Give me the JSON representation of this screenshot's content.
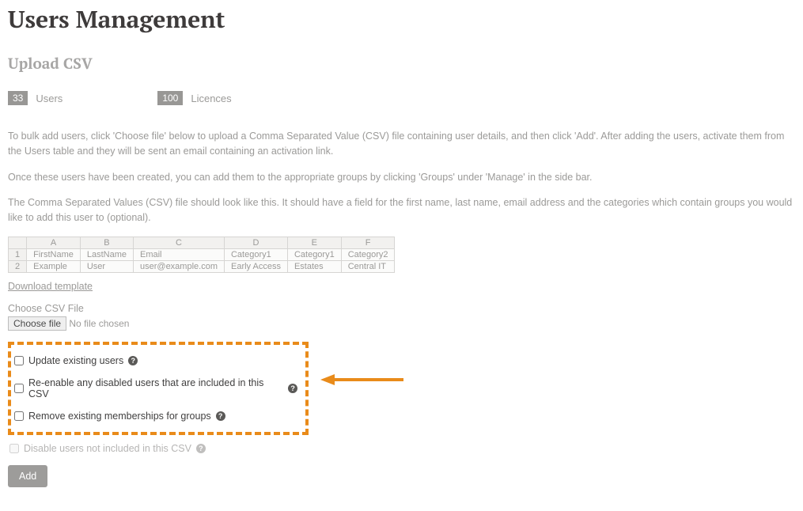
{
  "page_title": "Users Management",
  "section_title": "Upload CSV",
  "stats": {
    "users_count": "33",
    "users_label": "Users",
    "licences_count": "100",
    "licences_label": "Licences"
  },
  "paragraphs": {
    "p1": "To bulk add users, click 'Choose file' below to upload a Comma Separated Value (CSV) file containing user details, and then click 'Add'. After adding the users, activate them from the Users table and they will be sent an email containing an activation link.",
    "p2": "Once these users have been created, you can add them to the appropriate groups by clicking 'Groups' under 'Manage' in the side bar.",
    "p3": "The Comma Separated Values (CSV) file should look like this. It should have a field for the first name, last name, email address and the categories which contain groups you would like to add this user to (optional)."
  },
  "csv_example": {
    "cols": [
      "A",
      "B",
      "C",
      "D",
      "E",
      "F"
    ],
    "row1": [
      "FirstName",
      "LastName",
      "Email",
      "Category1",
      "Category1",
      "Category2"
    ],
    "row2": [
      "Example",
      "User",
      "user@example.com",
      "Early Access",
      "Estates",
      "Central IT"
    ]
  },
  "download_template": "Download template",
  "choose_label": "Choose CSV File",
  "choose_button": "Choose file",
  "no_file": "No file chosen",
  "checkboxes": {
    "update_existing": "Update existing users",
    "reenable": "Re-enable any disabled users that are included in this CSV",
    "remove_memberships": "Remove existing memberships for groups",
    "disable_not_included": "Disable users not included in this CSV"
  },
  "add_button": "Add",
  "help_char": "?"
}
